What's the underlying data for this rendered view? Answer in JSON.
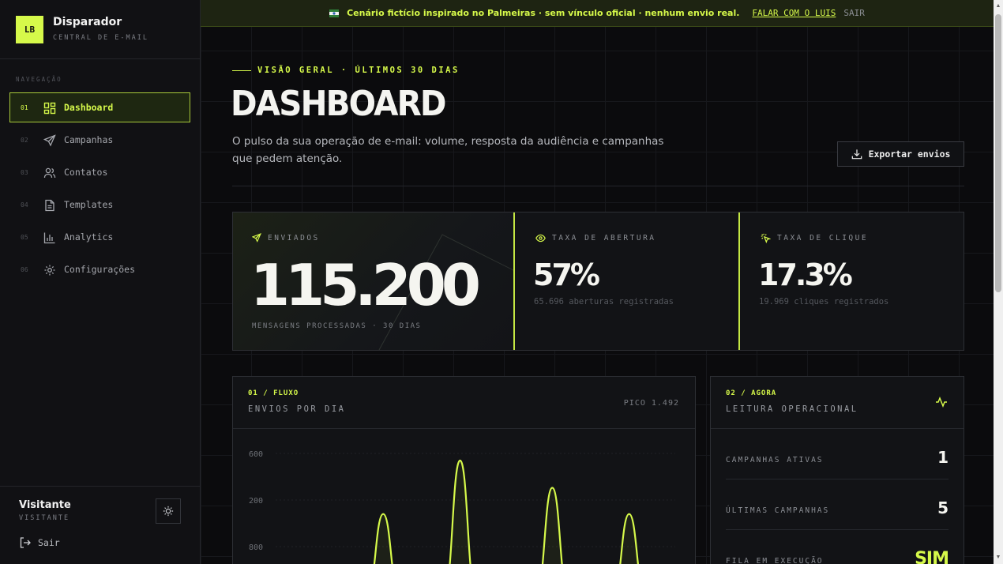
{
  "brand": {
    "logo": "LB",
    "name": "Disparador",
    "subtitle": "CENTRAL DE E-MAIL"
  },
  "nav": {
    "label": "NAVEGAÇÃO",
    "items": [
      {
        "num": "01",
        "label": "Dashboard",
        "icon": "grid-icon",
        "active": true
      },
      {
        "num": "02",
        "label": "Campanhas",
        "icon": "send-icon"
      },
      {
        "num": "03",
        "label": "Contatos",
        "icon": "users-icon"
      },
      {
        "num": "04",
        "label": "Templates",
        "icon": "document-icon"
      },
      {
        "num": "05",
        "label": "Analytics",
        "icon": "bar-chart-icon"
      },
      {
        "num": "06",
        "label": "Configurações",
        "icon": "gear-icon"
      }
    ]
  },
  "user": {
    "name": "Visitante",
    "role": "VISITANTE",
    "logout": "Sair"
  },
  "banner": {
    "text": "Cenário fictício inspirado no Palmeiras · sem vínculo oficial · nenhum envio real.",
    "link": "FALAR COM O LUIS",
    "exit": "SAIR"
  },
  "header": {
    "eyebrow": "VISÃO GERAL · ÚLTIMOS 30 DIAS",
    "title": "DASHBOARD",
    "description": "O pulso da sua operação de e-mail: volume, resposta da audiência e campanhas que pedem atenção.",
    "export": "Exportar envios"
  },
  "stats": {
    "sent": {
      "label": "ENVIADOS",
      "value": "115.200",
      "foot": "MENSAGENS PROCESSADAS · 30 DIAS"
    },
    "open": {
      "label": "TAXA DE ABERTURA",
      "value": "57%",
      "sub": "65.696 aberturas registradas"
    },
    "click": {
      "label": "TAXA DE CLIQUE",
      "value": "17.3%",
      "sub": "19.969 cliques registrados"
    }
  },
  "flow_card": {
    "tag": "01 / FLUXO",
    "title": "ENVIOS POR DIA",
    "peak": "PICO 1.492"
  },
  "ops_card": {
    "tag": "02 / AGORA",
    "title": "LEITURA OPERACIONAL",
    "rows": [
      {
        "label": "CAMPANHAS ATIVAS",
        "value": "1"
      },
      {
        "label": "ÚLTIMAS CAMPANHAS",
        "value": "5"
      },
      {
        "label": "FILA EM EXECUÇÃO",
        "value": "SIM"
      }
    ]
  },
  "colors": {
    "accent": "#d6f94a",
    "background": "#0b0b0d",
    "panel": "#121316"
  },
  "chart_data": {
    "type": "line",
    "title": "ENVIOS POR DIA",
    "y_tick_labels": [
      "600",
      "200",
      "800"
    ],
    "peak": 1492,
    "series": [
      {
        "values": [
          0,
          0,
          0,
          0,
          0,
          0,
          0,
          880,
          0,
          0,
          0,
          0,
          1492,
          0,
          0,
          0,
          0,
          0,
          1180,
          0,
          0,
          0,
          0,
          880,
          0,
          0,
          0
        ]
      }
    ]
  }
}
